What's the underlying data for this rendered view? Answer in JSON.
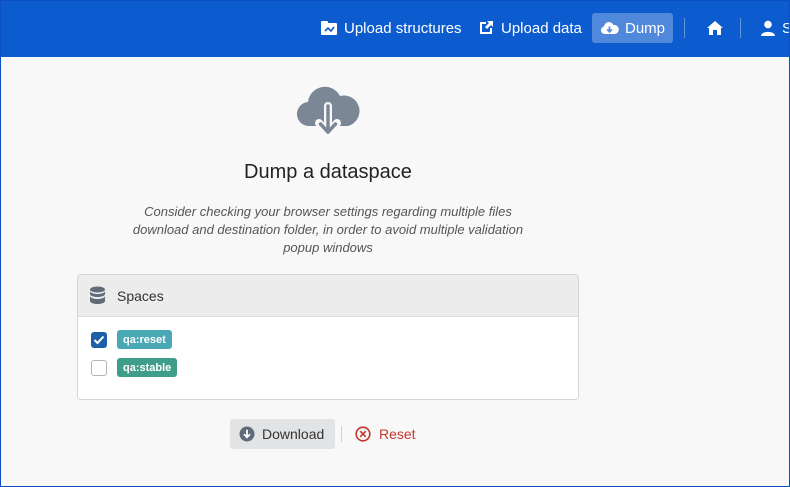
{
  "navbar": {
    "upload_structures": "Upload structures",
    "upload_data": "Upload data",
    "dump": "Dump",
    "user_partial": "S"
  },
  "main": {
    "title": "Dump a dataspace",
    "subtitle": "Consider checking your browser settings regarding multiple files download and destination folder, in order to avoid multiple validation popup windows",
    "spaces_header": "Spaces",
    "spaces": [
      {
        "label": "qa:reset",
        "checked": true,
        "color": "#4aa8b5"
      },
      {
        "label": "qa:stable",
        "checked": false,
        "color": "#3f9e8a"
      }
    ],
    "download_label": "Download",
    "reset_label": "Reset"
  },
  "colors": {
    "navbar": "#0d5ccf",
    "reset": "#c0392b",
    "checkbox_checked": "#1d5fa7"
  }
}
